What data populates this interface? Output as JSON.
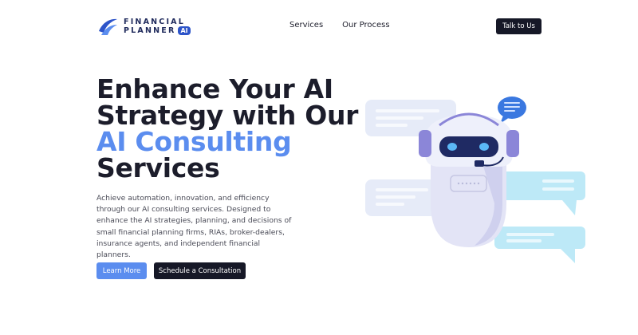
{
  "header": {
    "logo": {
      "line1": "FINANCIAL",
      "line2": "PLANNER",
      "badge": "AI"
    },
    "nav": [
      {
        "label": "Services"
      },
      {
        "label": "Our Process"
      }
    ],
    "cta_label": "Talk to Us"
  },
  "hero": {
    "title_line1": "Enhance Your AI",
    "title_line2": "Strategy with Our",
    "title_accent": "AI Consulting",
    "title_line4": "Services",
    "description": "Achieve automation, innovation, and efficiency through our AI consulting services. Designed to enhance the AI strategies, planning, and decisions of small financial planning firms, RIAs, broker-dealers, insurance agents, and independent financial planners.",
    "learn_more_label": "Learn More",
    "schedule_label": "Schedule a Consultation"
  },
  "colors": {
    "accent": "#5b8def",
    "dark": "#161827",
    "logo_blue": "#2d54c9",
    "bubble_blue": "#bde9f7",
    "bubble_gray": "#e6ebf8"
  },
  "icons": {
    "logo": "financial-planner-swoosh-logo",
    "illustration": "chatbot-robot-with-chat-bubbles"
  }
}
